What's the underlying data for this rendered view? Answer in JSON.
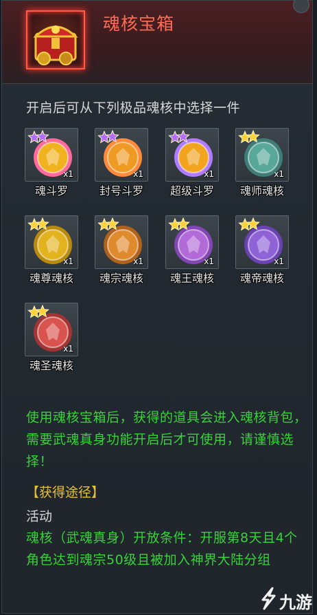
{
  "header": {
    "title": "魂核宝箱",
    "icon": "treasure-chest-icon"
  },
  "subtitle": "开启后可从下列极品魂核中选择一件",
  "items": [
    {
      "label": "魂斗罗",
      "qty": "x1",
      "stars": 2,
      "star_color": "#b46cff",
      "orb_color": "#f0b21e",
      "ring_color": "#ff6a9a"
    },
    {
      "label": "封号斗罗",
      "qty": "x1",
      "stars": 2,
      "star_color": "#b46cff",
      "orb_color": "#ef9a22",
      "ring_color": "#ff8a3a"
    },
    {
      "label": "超级斗罗",
      "qty": "x1",
      "stars": 2,
      "star_color": "#b46cff",
      "orb_color": "#f2a41f",
      "ring_color": "#b07cff"
    },
    {
      "label": "魂师魂核",
      "qty": "x1",
      "stars": 2,
      "star_color": "#ffd23a",
      "orb_color": "#58a89a",
      "ring_color": "#3f7d76"
    },
    {
      "label": "魂尊魂核",
      "qty": "x1",
      "stars": 2,
      "star_color": "#ffd23a",
      "orb_color": "#e3b21f",
      "ring_color": "#b98a10"
    },
    {
      "label": "魂宗魂核",
      "qty": "x1",
      "stars": 2,
      "star_color": "#ffd23a",
      "orb_color": "#e08a2e",
      "ring_color": "#b0611a"
    },
    {
      "label": "魂王魂核",
      "qty": "x1",
      "stars": 2,
      "star_color": "#ffd23a",
      "orb_color": "#b16ad8",
      "ring_color": "#8446b4"
    },
    {
      "label": "魂帝魂核",
      "qty": "x1",
      "stars": 2,
      "star_color": "#ffd23a",
      "orb_color": "#8f63d6",
      "ring_color": "#6a42b2"
    },
    {
      "label": "魂圣魂核",
      "qty": "x1",
      "stars": 2,
      "star_color": "#ffd23a",
      "orb_color": "#d9544e",
      "ring_color": "#a23434"
    }
  ],
  "description": "使用魂核宝箱后，获得的道具会进入魂核背包，需要武魂真身功能开启后才可使用，请谨慎选择！",
  "acquire": {
    "title": "【获得途径】",
    "activity": "活动",
    "condition": "魂核（武魂真身）开放条件：开服第8天且4个角色达到魂宗50级且被加入神界大陆分组"
  },
  "watermark": {
    "text": "九游",
    "icon": "jiuyou-logo-icon"
  },
  "colors": {
    "title": "#ff6a55",
    "green_text": "#39d23a",
    "section_title": "#e8c038"
  }
}
